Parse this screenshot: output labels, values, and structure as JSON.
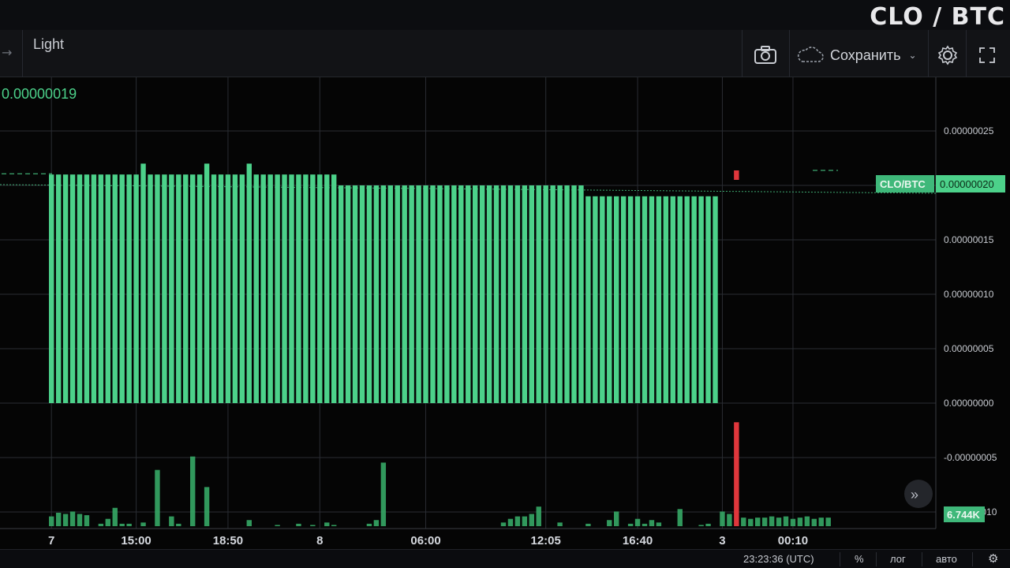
{
  "header": {
    "pair": "CLO / BTC"
  },
  "toolbar": {
    "theme_label": "Light",
    "save_label": "Сохранить",
    "icons": [
      "camera-icon",
      "cloud-icon",
      "gear-icon",
      "fullscreen-icon"
    ]
  },
  "legend": {
    "last_value": "0.00000019"
  },
  "price_tag": {
    "label": "CLO/BTC",
    "value": "0.00000020"
  },
  "volume_tag": {
    "value": "6.744K"
  },
  "bottom": {
    "time": "23:23:36 (UTC)",
    "percent": "%",
    "log": "лог",
    "auto": "авто"
  },
  "colors": {
    "up": "#4cd18a",
    "down": "#e0373c",
    "background": "#050505",
    "grid": "#2a2d33"
  },
  "chart_data": {
    "type": "bar",
    "title": "CLO / BTC",
    "price_axis": {
      "ticks": [
        "0.00000025",
        "0.00000020",
        "0.00000015",
        "0.00000010",
        "0.00000005",
        "0.00000000",
        "-0.00000005",
        "-0.00000010"
      ],
      "tick_values": [
        2.5e-07,
        2e-07,
        1.5e-07,
        1e-07,
        5e-08,
        0,
        -5e-08,
        -1e-07
      ],
      "range": [
        -1e-07,
        2.9e-07
      ]
    },
    "time_axis": {
      "ticks": [
        "7",
        "15:00",
        "18:50",
        "8",
        "06:00",
        "12:05",
        "16:40",
        "3",
        "00:10"
      ],
      "tick_index": [
        0,
        12,
        25,
        38,
        53,
        70,
        83,
        95,
        105
      ]
    },
    "series": [
      {
        "name": "CLO/BTC",
        "values": [
          2.1e-07,
          2.1e-07,
          2.1e-07,
          2.1e-07,
          2.1e-07,
          2.1e-07,
          2.1e-07,
          2.1e-07,
          2.1e-07,
          2.1e-07,
          2.1e-07,
          2.1e-07,
          2.1e-07,
          2.1e-07,
          2.1e-07,
          2.1e-07,
          2.1e-07,
          2.1e-07,
          2.1e-07,
          2.1e-07,
          2.1e-07,
          2.1e-07,
          2.1e-07,
          2.1e-07,
          2.1e-07,
          2.1e-07,
          2.1e-07,
          2.1e-07,
          2.1e-07,
          2.1e-07,
          2.1e-07,
          2.1e-07,
          2.1e-07,
          2.1e-07,
          2.1e-07,
          2.1e-07,
          2.1e-07,
          2.1e-07,
          2.1e-07,
          2.1e-07,
          2e-07,
          2e-07,
          2e-07,
          2e-07,
          2e-07,
          2e-07,
          2e-07,
          2e-07,
          2e-07,
          2e-07,
          2e-07,
          2e-07,
          2e-07,
          2e-07,
          2e-07,
          2e-07,
          2e-07,
          2e-07,
          2e-07,
          2e-07,
          2e-07,
          2e-07,
          2e-07,
          2e-07,
          2e-07,
          2e-07,
          2e-07,
          2e-07,
          2e-07,
          2e-07,
          2e-07,
          2e-07,
          2e-07,
          2e-07,
          2e-07,
          1.9e-07,
          1.9e-07,
          1.9e-07,
          1.9e-07,
          1.9e-07,
          1.9e-07,
          1.9e-07,
          1.9e-07,
          1.9e-07,
          1.9e-07,
          1.9e-07,
          1.9e-07,
          1.9e-07,
          1.9e-07,
          1.9e-07,
          1.9e-07,
          1.9e-07,
          1.9e-07,
          1.9e-07,
          1.9e-07,
          0.0,
          0.0,
          2.1e-07,
          0.0,
          0.0,
          0.0,
          0.0,
          0.0,
          0.0,
          0.0,
          0.0,
          0.0,
          0.0,
          0.0,
          0.0,
          0.0
        ],
        "highs": [
          2.1e-07,
          2.1e-07,
          2.1e-07,
          2.1e-07,
          2.1e-07,
          2.1e-07,
          2.1e-07,
          2.1e-07,
          2.1e-07,
          2.1e-07,
          2.1e-07,
          2.1e-07,
          2.1e-07,
          2.2e-07,
          2.1e-07,
          2.1e-07,
          2.1e-07,
          2.1e-07,
          2.1e-07,
          2.1e-07,
          2.1e-07,
          2.1e-07,
          2.2e-07,
          2.1e-07,
          2.1e-07,
          2.1e-07,
          2.1e-07,
          2.1e-07,
          2.2e-07,
          2.1e-07,
          2.1e-07,
          2.1e-07,
          2.1e-07,
          2.1e-07,
          2.1e-07,
          2.1e-07,
          2.1e-07,
          2.1e-07,
          2.1e-07,
          2.1e-07,
          2.1e-07,
          2e-07,
          2e-07,
          2e-07,
          2e-07,
          2e-07,
          2e-07,
          2e-07,
          2e-07,
          2e-07,
          2e-07,
          2e-07,
          2e-07,
          2e-07,
          2e-07,
          2e-07,
          2e-07,
          2e-07,
          2e-07,
          2e-07,
          2e-07,
          2e-07,
          2e-07,
          2e-07,
          2e-07,
          2e-07,
          2e-07,
          2e-07,
          2e-07,
          2e-07,
          2e-07,
          2e-07,
          2e-07,
          2e-07,
          2e-07,
          2e-07,
          1.9e-07,
          1.9e-07,
          1.9e-07,
          1.9e-07,
          1.9e-07,
          1.9e-07,
          1.9e-07,
          1.9e-07,
          1.9e-07,
          1.9e-07,
          1.9e-07,
          1.9e-07,
          1.9e-07,
          1.9e-07,
          1.9e-07,
          1.9e-07,
          1.9e-07,
          1.9e-07,
          1.9e-07,
          0.0,
          0.0,
          2.1e-07,
          0.0,
          0.0,
          0.0,
          0.0,
          0.0,
          0.0,
          0.0,
          0.0,
          0.0,
          0.0,
          0.0,
          0.0,
          0.0
        ]
      }
    ],
    "volume": {
      "values": [
        0.8,
        1.1,
        1.0,
        1.2,
        1.0,
        0.9,
        0.0,
        0.2,
        0.6,
        1.5,
        0.2,
        0.2,
        0.0,
        0.3,
        0.0,
        4.6,
        0.0,
        0.8,
        0.2,
        0.0,
        5.7,
        0.0,
        3.2,
        0.0,
        0.0,
        0.0,
        0.0,
        0.0,
        0.5,
        0.0,
        0.0,
        0.0,
        0.1,
        0.0,
        0.0,
        0.2,
        0.0,
        0.1,
        0.0,
        0.3,
        0.1,
        0.0,
        0.0,
        0.0,
        0.0,
        0.2,
        0.5,
        5.2,
        0.0,
        0.0,
        0.0,
        0.0,
        0.0,
        0.0,
        0.0,
        0.0,
        0.0,
        0.0,
        0.0,
        0.0,
        0.0,
        0.0,
        0.0,
        0.0,
        0.3,
        0.6,
        0.8,
        0.8,
        1.0,
        1.6,
        0.0,
        0.0,
        0.3,
        0.0,
        0.0,
        0.0,
        0.2,
        0.0,
        0.0,
        0.5,
        1.2,
        0.0,
        0.2,
        0.6,
        0.2,
        0.5,
        0.3,
        0.0,
        0.0,
        1.4,
        0.0,
        0.0,
        0.1,
        0.2,
        0.0,
        1.2,
        1.0,
        8.5,
        0.7,
        0.6,
        0.7,
        0.7,
        0.8,
        0.7,
        0.8,
        0.6,
        0.7,
        0.8,
        0.6,
        0.7,
        0.7
      ],
      "down_index": [
        97
      ]
    }
  }
}
